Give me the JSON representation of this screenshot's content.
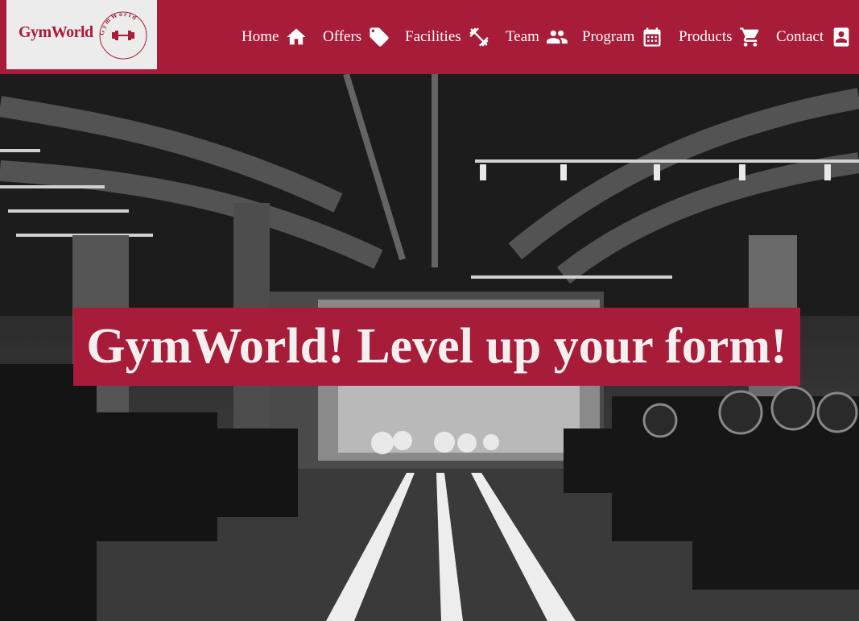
{
  "brand": {
    "name": "GymWorld",
    "badge_text": "GymWorld",
    "accent_color": "#a71c39"
  },
  "nav": {
    "items": [
      {
        "label": "Home",
        "icon": "home-icon"
      },
      {
        "label": "Offers",
        "icon": "tag-icon"
      },
      {
        "label": "Facilities",
        "icon": "dumbbell-icon"
      },
      {
        "label": "Team",
        "icon": "people-icon"
      },
      {
        "label": "Program",
        "icon": "calendar-icon"
      },
      {
        "label": "Products",
        "icon": "cart-icon"
      },
      {
        "label": "Contact",
        "icon": "contact-card-icon"
      }
    ]
  },
  "hero": {
    "headline": "GymWorld! Level up your form!",
    "image": "gym-interior-photo"
  }
}
